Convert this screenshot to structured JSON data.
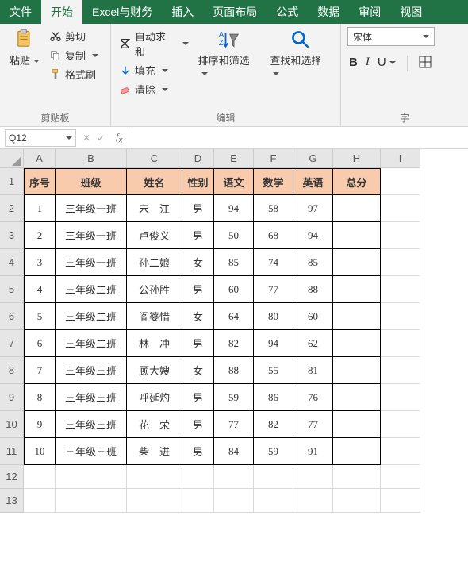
{
  "menu": {
    "file": "文件",
    "home": "开始",
    "excel_finance": "Excel与财务",
    "insert": "插入",
    "layout": "页面布局",
    "formula": "公式",
    "data": "数据",
    "review": "审阅",
    "view": "视图"
  },
  "ribbon": {
    "clipboard": {
      "title": "剪贴板",
      "paste": "粘贴",
      "cut": "剪切",
      "copy": "复制",
      "format_painter": "格式刷"
    },
    "edit": {
      "title": "编辑",
      "autosum": "自动求和",
      "fill": "填充",
      "clear": "清除",
      "sort_filter": "排序和筛选",
      "find_select": "查找和选择"
    },
    "font": {
      "title": "字",
      "name": "宋体",
      "bold": "B",
      "italic": "I",
      "underline": "U"
    }
  },
  "namebox": "Q12",
  "cols": [
    "A",
    "B",
    "C",
    "D",
    "E",
    "F",
    "G",
    "H",
    "I"
  ],
  "headers": {
    "c1": "序号",
    "c2": "班级",
    "c3": "姓名",
    "c4": "性别",
    "c5": "语文",
    "c6": "数学",
    "c7": "英语",
    "c8": "总分"
  },
  "rows": [
    {
      "n": "1",
      "cls": "三年级一班",
      "name": "宋　江",
      "sex": "男",
      "a": "94",
      "b": "58",
      "c": "97"
    },
    {
      "n": "2",
      "cls": "三年级一班",
      "name": "卢俊义",
      "sex": "男",
      "a": "50",
      "b": "68",
      "c": "94"
    },
    {
      "n": "3",
      "cls": "三年级一班",
      "name": "孙二娘",
      "sex": "女",
      "a": "85",
      "b": "74",
      "c": "85"
    },
    {
      "n": "4",
      "cls": "三年级二班",
      "name": "公孙胜",
      "sex": "男",
      "a": "60",
      "b": "77",
      "c": "88"
    },
    {
      "n": "5",
      "cls": "三年级二班",
      "name": "阎婆惜",
      "sex": "女",
      "a": "64",
      "b": "80",
      "c": "60"
    },
    {
      "n": "6",
      "cls": "三年级二班",
      "name": "林　冲",
      "sex": "男",
      "a": "82",
      "b": "94",
      "c": "62"
    },
    {
      "n": "7",
      "cls": "三年级三班",
      "name": "顾大嫂",
      "sex": "女",
      "a": "88",
      "b": "55",
      "c": "81"
    },
    {
      "n": "8",
      "cls": "三年级三班",
      "name": "呼延灼",
      "sex": "男",
      "a": "59",
      "b": "86",
      "c": "76"
    },
    {
      "n": "9",
      "cls": "三年级三班",
      "name": "花　荣",
      "sex": "男",
      "a": "77",
      "b": "82",
      "c": "77"
    },
    {
      "n": "10",
      "cls": "三年级三班",
      "name": "柴　进",
      "sex": "男",
      "a": "84",
      "b": "59",
      "c": "91"
    }
  ],
  "rownums": [
    "1",
    "2",
    "3",
    "4",
    "5",
    "6",
    "7",
    "8",
    "9",
    "10",
    "11",
    "12",
    "13"
  ]
}
